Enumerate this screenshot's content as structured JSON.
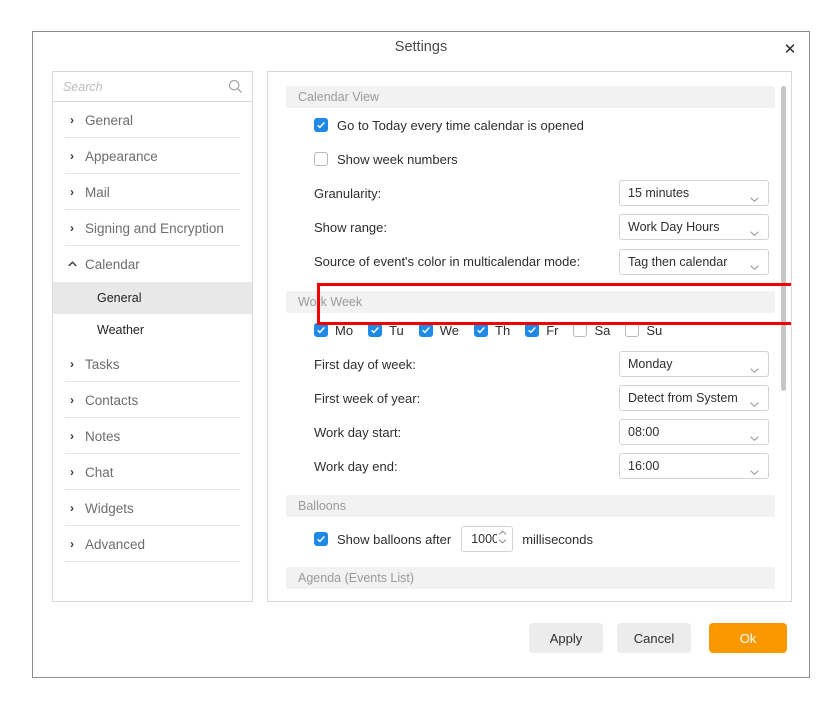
{
  "dialog": {
    "title": "Settings",
    "close_label": "✕"
  },
  "sidebar": {
    "search": {
      "placeholder": "Search",
      "value": "",
      "icon": "search-icon"
    },
    "items": [
      {
        "label": "General",
        "type": "group",
        "expanded": false,
        "icon": "chevron-right-icon"
      },
      {
        "label": "Appearance",
        "type": "group",
        "expanded": false,
        "icon": "chevron-right-icon"
      },
      {
        "label": "Mail",
        "type": "group",
        "expanded": false,
        "icon": "chevron-right-icon"
      },
      {
        "label": "Signing and Encryption",
        "type": "group",
        "expanded": false,
        "icon": "chevron-right-icon"
      },
      {
        "label": "Calendar",
        "type": "group",
        "expanded": true,
        "icon": "chevron-up-icon"
      },
      {
        "label": "General",
        "type": "child",
        "selected": true
      },
      {
        "label": "Weather",
        "type": "child",
        "selected": false
      },
      {
        "label": "Tasks",
        "type": "group",
        "expanded": false,
        "icon": "chevron-right-icon"
      },
      {
        "label": "Contacts",
        "type": "group",
        "expanded": false,
        "icon": "chevron-right-icon"
      },
      {
        "label": "Notes",
        "type": "group",
        "expanded": false,
        "icon": "chevron-right-icon"
      },
      {
        "label": "Chat",
        "type": "group",
        "expanded": false,
        "icon": "chevron-right-icon"
      },
      {
        "label": "Widgets",
        "type": "group",
        "expanded": false,
        "icon": "chevron-right-icon"
      },
      {
        "label": "Advanced",
        "type": "group",
        "expanded": false,
        "icon": "chevron-right-icon"
      }
    ]
  },
  "content": {
    "sections": [
      {
        "header": "Calendar View",
        "rows": [
          {
            "kind": "checkbox",
            "label": "Go to Today every time calendar is opened",
            "checked": true
          },
          {
            "kind": "checkbox",
            "label": "Show week numbers",
            "checked": false
          },
          {
            "kind": "dropdown",
            "label": "Granularity:",
            "value": "15 minutes"
          },
          {
            "kind": "dropdown",
            "label": "Show range:",
            "value": "Work Day Hours"
          },
          {
            "kind": "dropdown",
            "label": "Source of event's color in multicalendar mode:",
            "value": "Tag then calendar",
            "highlighted": true
          }
        ]
      },
      {
        "header": "Work Week",
        "days": [
          {
            "label": "Mo",
            "checked": true
          },
          {
            "label": "Tu",
            "checked": true
          },
          {
            "label": "We",
            "checked": true
          },
          {
            "label": "Th",
            "checked": true
          },
          {
            "label": "Fr",
            "checked": true
          },
          {
            "label": "Sa",
            "checked": false
          },
          {
            "label": "Su",
            "checked": false
          }
        ],
        "rows": [
          {
            "kind": "dropdown",
            "label": "First day of week:",
            "value": "Monday"
          },
          {
            "kind": "dropdown",
            "label": "First week of year:",
            "value": "Detect from System"
          },
          {
            "kind": "dropdown",
            "label": "Work day start:",
            "value": "08:00"
          },
          {
            "kind": "dropdown",
            "label": "Work day end:",
            "value": "16:00"
          }
        ]
      },
      {
        "header": "Balloons",
        "balloon": {
          "checkbox_label": "Show balloons after",
          "checked": true,
          "value": "1000",
          "unit": "milliseconds"
        }
      },
      {
        "header": "Agenda (Events List)"
      }
    ]
  },
  "footer": {
    "apply_label": "Apply",
    "cancel_label": "Cancel",
    "ok_label": "Ok"
  },
  "colors": {
    "accent_checkbox": "#1e8ae6",
    "primary_button": "#fa9800",
    "highlight_border": "#f50000",
    "section_header_bg": "#f2f2f2"
  }
}
